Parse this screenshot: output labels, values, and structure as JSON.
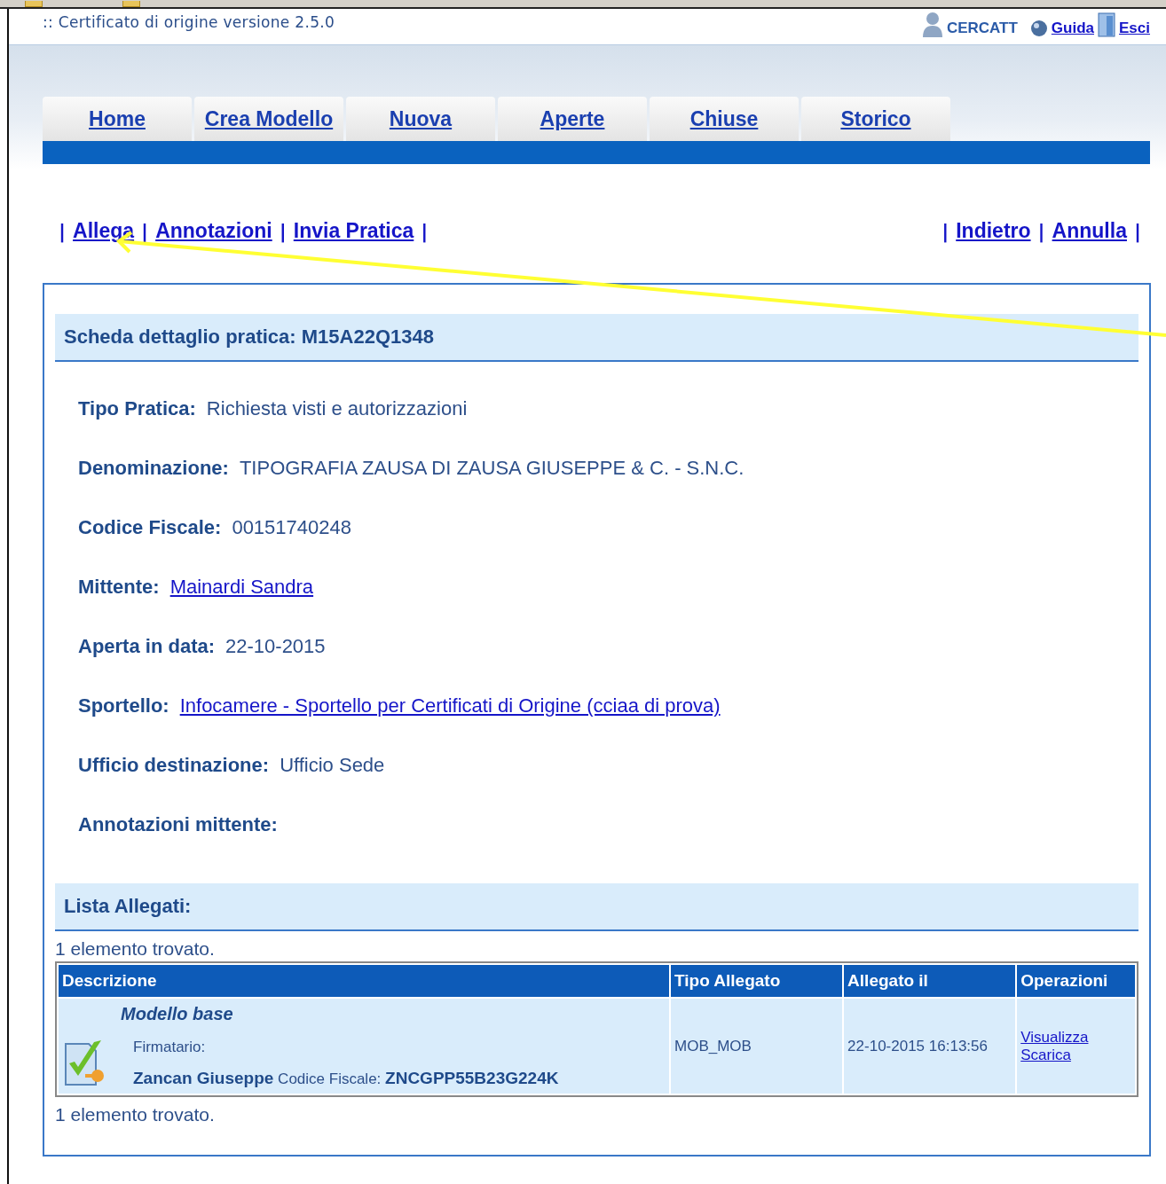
{
  "header": {
    "title": ":: Certificato di origine versione 2.5.0",
    "user": "CERCATT",
    "links": [
      {
        "label": "Guida",
        "kind": "help"
      },
      {
        "label": "Esci",
        "kind": "exit"
      }
    ]
  },
  "tabs": [
    {
      "label": "Home"
    },
    {
      "label": "Crea Modello"
    },
    {
      "label": "Nuova"
    },
    {
      "label": "Aperte"
    },
    {
      "label": "Chiuse"
    },
    {
      "label": "Storico"
    }
  ],
  "actions_left": [
    {
      "kind": "separator",
      "text": "|"
    },
    {
      "kind": "link",
      "text": "Allega"
    },
    {
      "kind": "separator",
      "text": "|"
    },
    {
      "kind": "link",
      "text": "Annotazioni"
    },
    {
      "kind": "separator",
      "text": "|"
    },
    {
      "kind": "link",
      "text": "Invia Pratica"
    },
    {
      "kind": "separator",
      "text": "|"
    }
  ],
  "actions_right": [
    {
      "kind": "separator",
      "text": "|"
    },
    {
      "kind": "link",
      "text": "Indietro"
    },
    {
      "kind": "separator",
      "text": "|"
    },
    {
      "kind": "link",
      "text": "Annulla"
    },
    {
      "kind": "separator",
      "text": "|"
    }
  ],
  "detail": {
    "title": "Scheda dettaglio pratica: M15A22Q1348",
    "fields": [
      {
        "label": "Tipo Pratica:",
        "value": "Richiesta visti e autorizzazioni",
        "kind": "text"
      },
      {
        "label": "Denominazione:",
        "value": "TIPOGRAFIA ZAUSA DI ZAUSA GIUSEPPE & C. - S.N.C.",
        "kind": "text"
      },
      {
        "label": "Codice Fiscale:",
        "value": "00151740248",
        "kind": "text"
      },
      {
        "label": "Mittente:",
        "value": "Mainardi Sandra",
        "kind": "link"
      },
      {
        "label": "Aperta in data:",
        "value": "22-10-2015",
        "kind": "text"
      },
      {
        "label": "Sportello:",
        "value": "Infocamere - Sportello per Certificati di Origine (cciaa di prova)",
        "kind": "link"
      },
      {
        "label": "Ufficio destinazione:",
        "value": "Ufficio Sede",
        "kind": "text"
      },
      {
        "label": "Annotazioni mittente:",
        "kind": "label_only"
      }
    ]
  },
  "attachments": {
    "title": "Lista Allegati:",
    "count_top": "1 elemento trovato.",
    "count_bottom": "1 elemento trovato.",
    "columns": [
      "Descrizione",
      "Tipo Allegato",
      "Allegato il",
      "Operazioni"
    ],
    "rows": [
      {
        "name": "Modello base",
        "signer_label": "Firmatario:",
        "signer": "Zancan Giuseppe",
        "cf_label": "Codice Fiscale:",
        "cf": "ZNCGPP55B23G224K",
        "type": "MOB_MOB",
        "date": "22-10-2015 16:13:56",
        "operations": [
          "Visualizza",
          "Scarica"
        ]
      }
    ]
  }
}
